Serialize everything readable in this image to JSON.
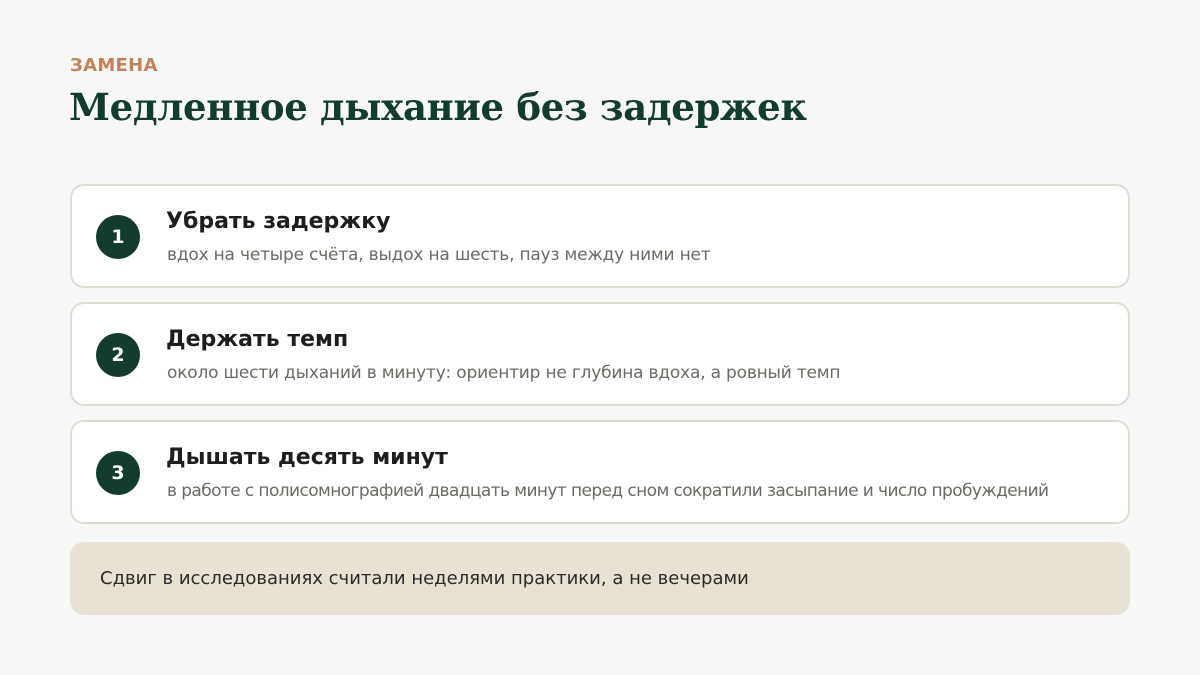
{
  "header": {
    "kicker": "ЗАМЕНА",
    "title": "Медленное дыхание без задержек"
  },
  "steps": [
    {
      "number": "1",
      "title": "Убрать задержку",
      "description": "вдох на четыре счёта, выдох на шесть, пауз между ними нет"
    },
    {
      "number": "2",
      "title": "Держать темп",
      "description": "около шести дыханий в минуту: ориентир не глубина вдоха, а ровный темп"
    },
    {
      "number": "3",
      "title": "Дышать десять минут",
      "description": "в работе с полисомнографией двадцать минут перед сном сократили засыпание и число пробуждений"
    }
  ],
  "note": {
    "text": "Сдвиг в исследованиях считали неделями практики, а не вечерами"
  },
  "colors": {
    "background": "#f7f7f5",
    "accent_kicker": "#c0835a",
    "primary_green": "#123d2e",
    "card_border": "#deddd3",
    "note_background": "#e8e2d5"
  }
}
